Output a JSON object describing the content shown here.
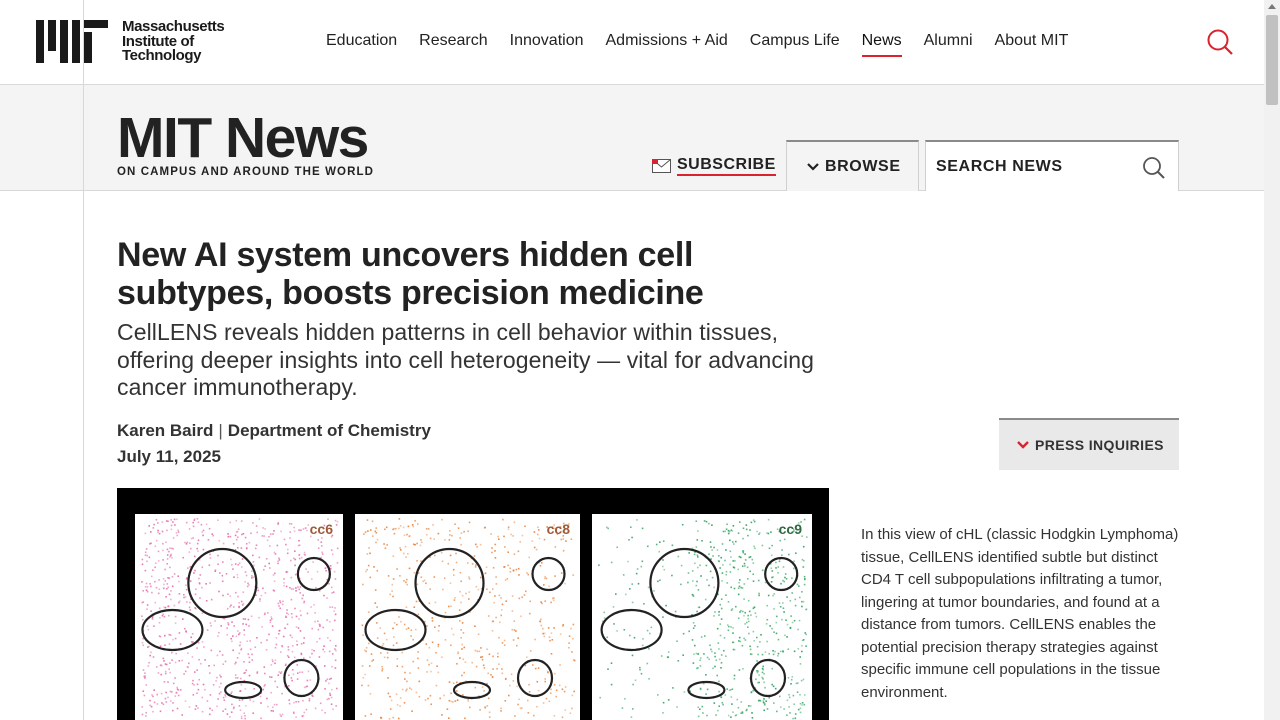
{
  "header": {
    "logo_lines": [
      "Massachusetts",
      "Institute of",
      "Technology"
    ],
    "nav": [
      {
        "label": "Education"
      },
      {
        "label": "Research"
      },
      {
        "label": "Innovation"
      },
      {
        "label": "Admissions + Aid"
      },
      {
        "label": "Campus Life"
      },
      {
        "label": "News",
        "active": true
      },
      {
        "label": "Alumni"
      },
      {
        "label": "About MIT"
      }
    ],
    "search_icon": "search-icon",
    "accent": "#d9232e"
  },
  "news_header": {
    "title": "MIT News",
    "tagline": "ON CAMPUS AND AROUND THE WORLD",
    "subscribe_label": "SUBSCRIBE",
    "browse_label": "BROWSE",
    "search_placeholder": "SEARCH NEWS"
  },
  "article": {
    "headline": "New AI system uncovers hidden cell subtypes, boosts precision medicine",
    "dek": "CellLENS reveals hidden patterns in cell behavior within tissues, offering deeper insights into cell heterogeneity — vital for advancing cancer immunotherapy.",
    "author": "Karen Baird",
    "department": "Department of Chemistry",
    "byline_separator": "|",
    "date": "July 11, 2025",
    "press_inquiries_label": "PRESS INQUIRIES",
    "figure_labels": [
      "cc6",
      "cc8",
      "cc9"
    ],
    "figure_colors": [
      "#e46aa8",
      "#e8823a",
      "#2fa35d"
    ],
    "caption": "In this view of cHL (classic Hodgkin Lymphoma) tissue, CellLENS identified subtle but distinct CD4 T cell subpopulations infiltrating a tumor, lingering at tumor boundaries, and found at a distance from tumors. CellLENS enables the potential precision therapy strategies against specific immune cell populations in the tissue environment."
  }
}
